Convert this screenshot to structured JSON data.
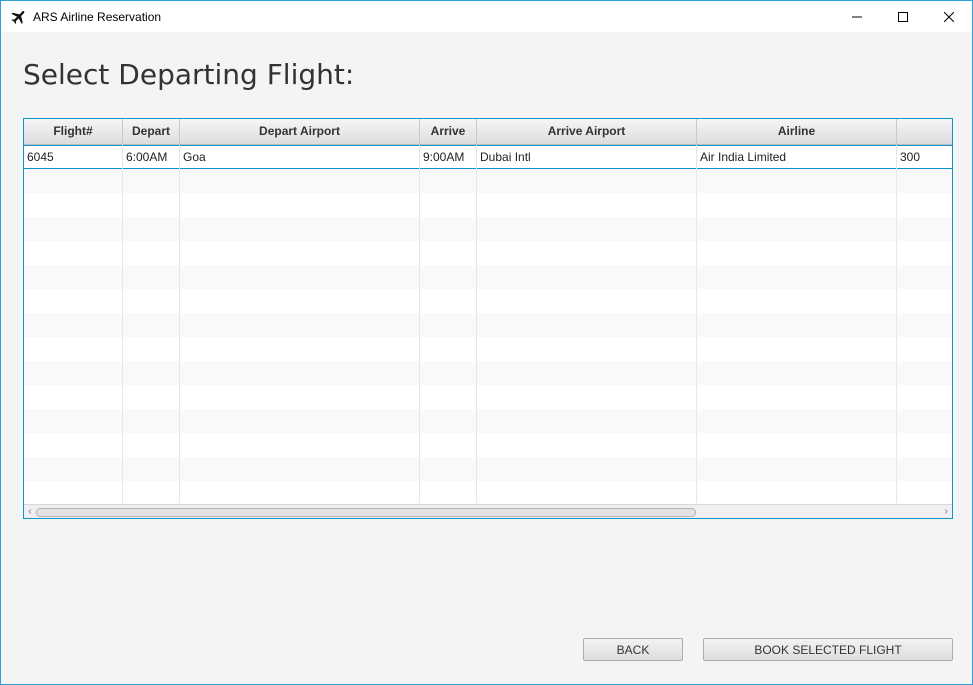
{
  "window": {
    "title": "ARS Airline Reservation",
    "icons": {
      "app": "airplane-icon",
      "minimize": "minimize-icon",
      "maximize": "maximize-icon",
      "close": "close-icon"
    }
  },
  "page": {
    "heading": "Select Departing Flight:"
  },
  "table": {
    "columns": [
      "Flight#",
      "Depart",
      "Depart Airport",
      "Arrive",
      "Arrive Airport",
      "Airline",
      ""
    ],
    "rows": [
      [
        "6045",
        "6:00AM",
        "Goa",
        "9:00AM",
        "Dubai Intl",
        "Air India Limited",
        "300"
      ]
    ],
    "scroll": {
      "left_arrow": "‹",
      "right_arrow": "›"
    }
  },
  "buttons": {
    "back": "BACK",
    "book": "BOOK SELECTED FLIGHT"
  },
  "colors": {
    "accent": "#0e93d0",
    "window_border": "#2b9fd6"
  }
}
